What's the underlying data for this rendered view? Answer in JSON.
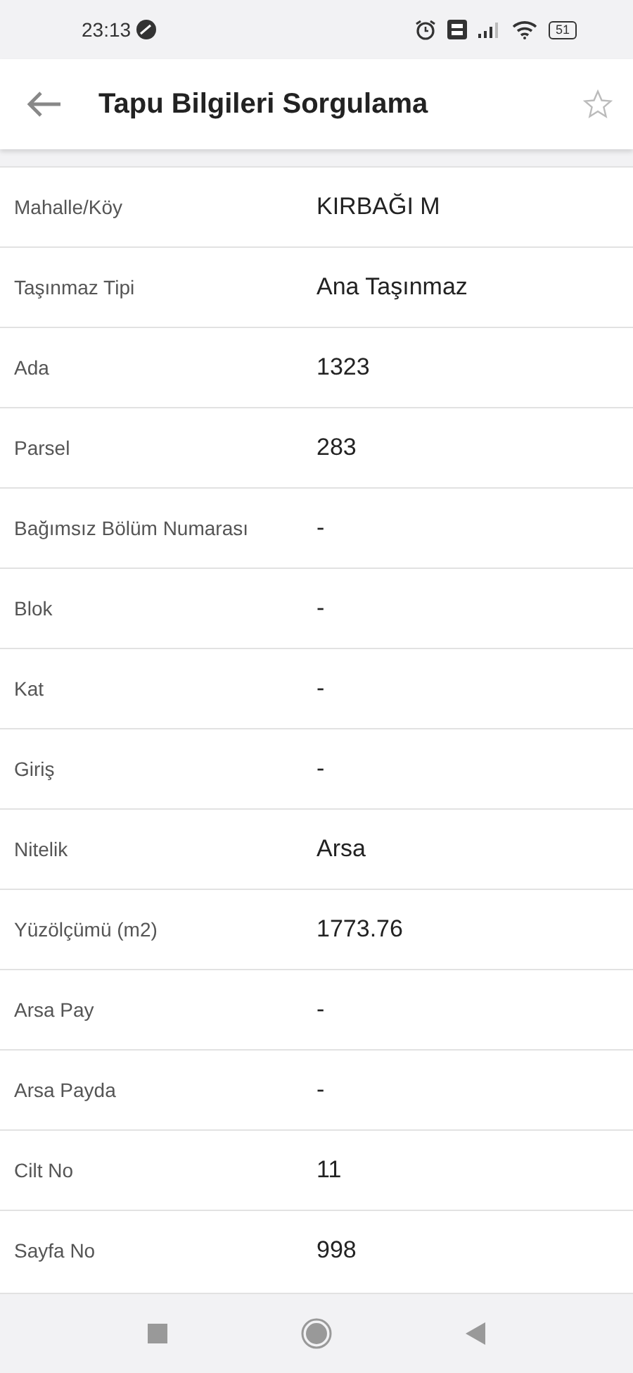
{
  "status_bar": {
    "time": "23:13",
    "battery": "51"
  },
  "header": {
    "title": "Tapu Bilgileri Sorgulama",
    "favorite": false
  },
  "rows": [
    {
      "label": "Mahalle/Köy",
      "value": "KIRBAĞI M"
    },
    {
      "label": "Taşınmaz Tipi",
      "value": "Ana Taşınmaz"
    },
    {
      "label": "Ada",
      "value": "1323"
    },
    {
      "label": "Parsel",
      "value": "283"
    },
    {
      "label": "Bağımsız Bölüm Numarası",
      "value": "-"
    },
    {
      "label": "Blok",
      "value": "-"
    },
    {
      "label": "Kat",
      "value": "-"
    },
    {
      "label": "Giriş",
      "value": "-"
    },
    {
      "label": "Nitelik",
      "value": "Arsa"
    },
    {
      "label": "Yüzölçümü (m2)",
      "value": "1773.76"
    },
    {
      "label": "Arsa Pay",
      "value": "-"
    },
    {
      "label": "Arsa Payda",
      "value": "-"
    },
    {
      "label": "Cilt No",
      "value": "11"
    },
    {
      "label": "Sayfa No",
      "value": "998"
    }
  ]
}
